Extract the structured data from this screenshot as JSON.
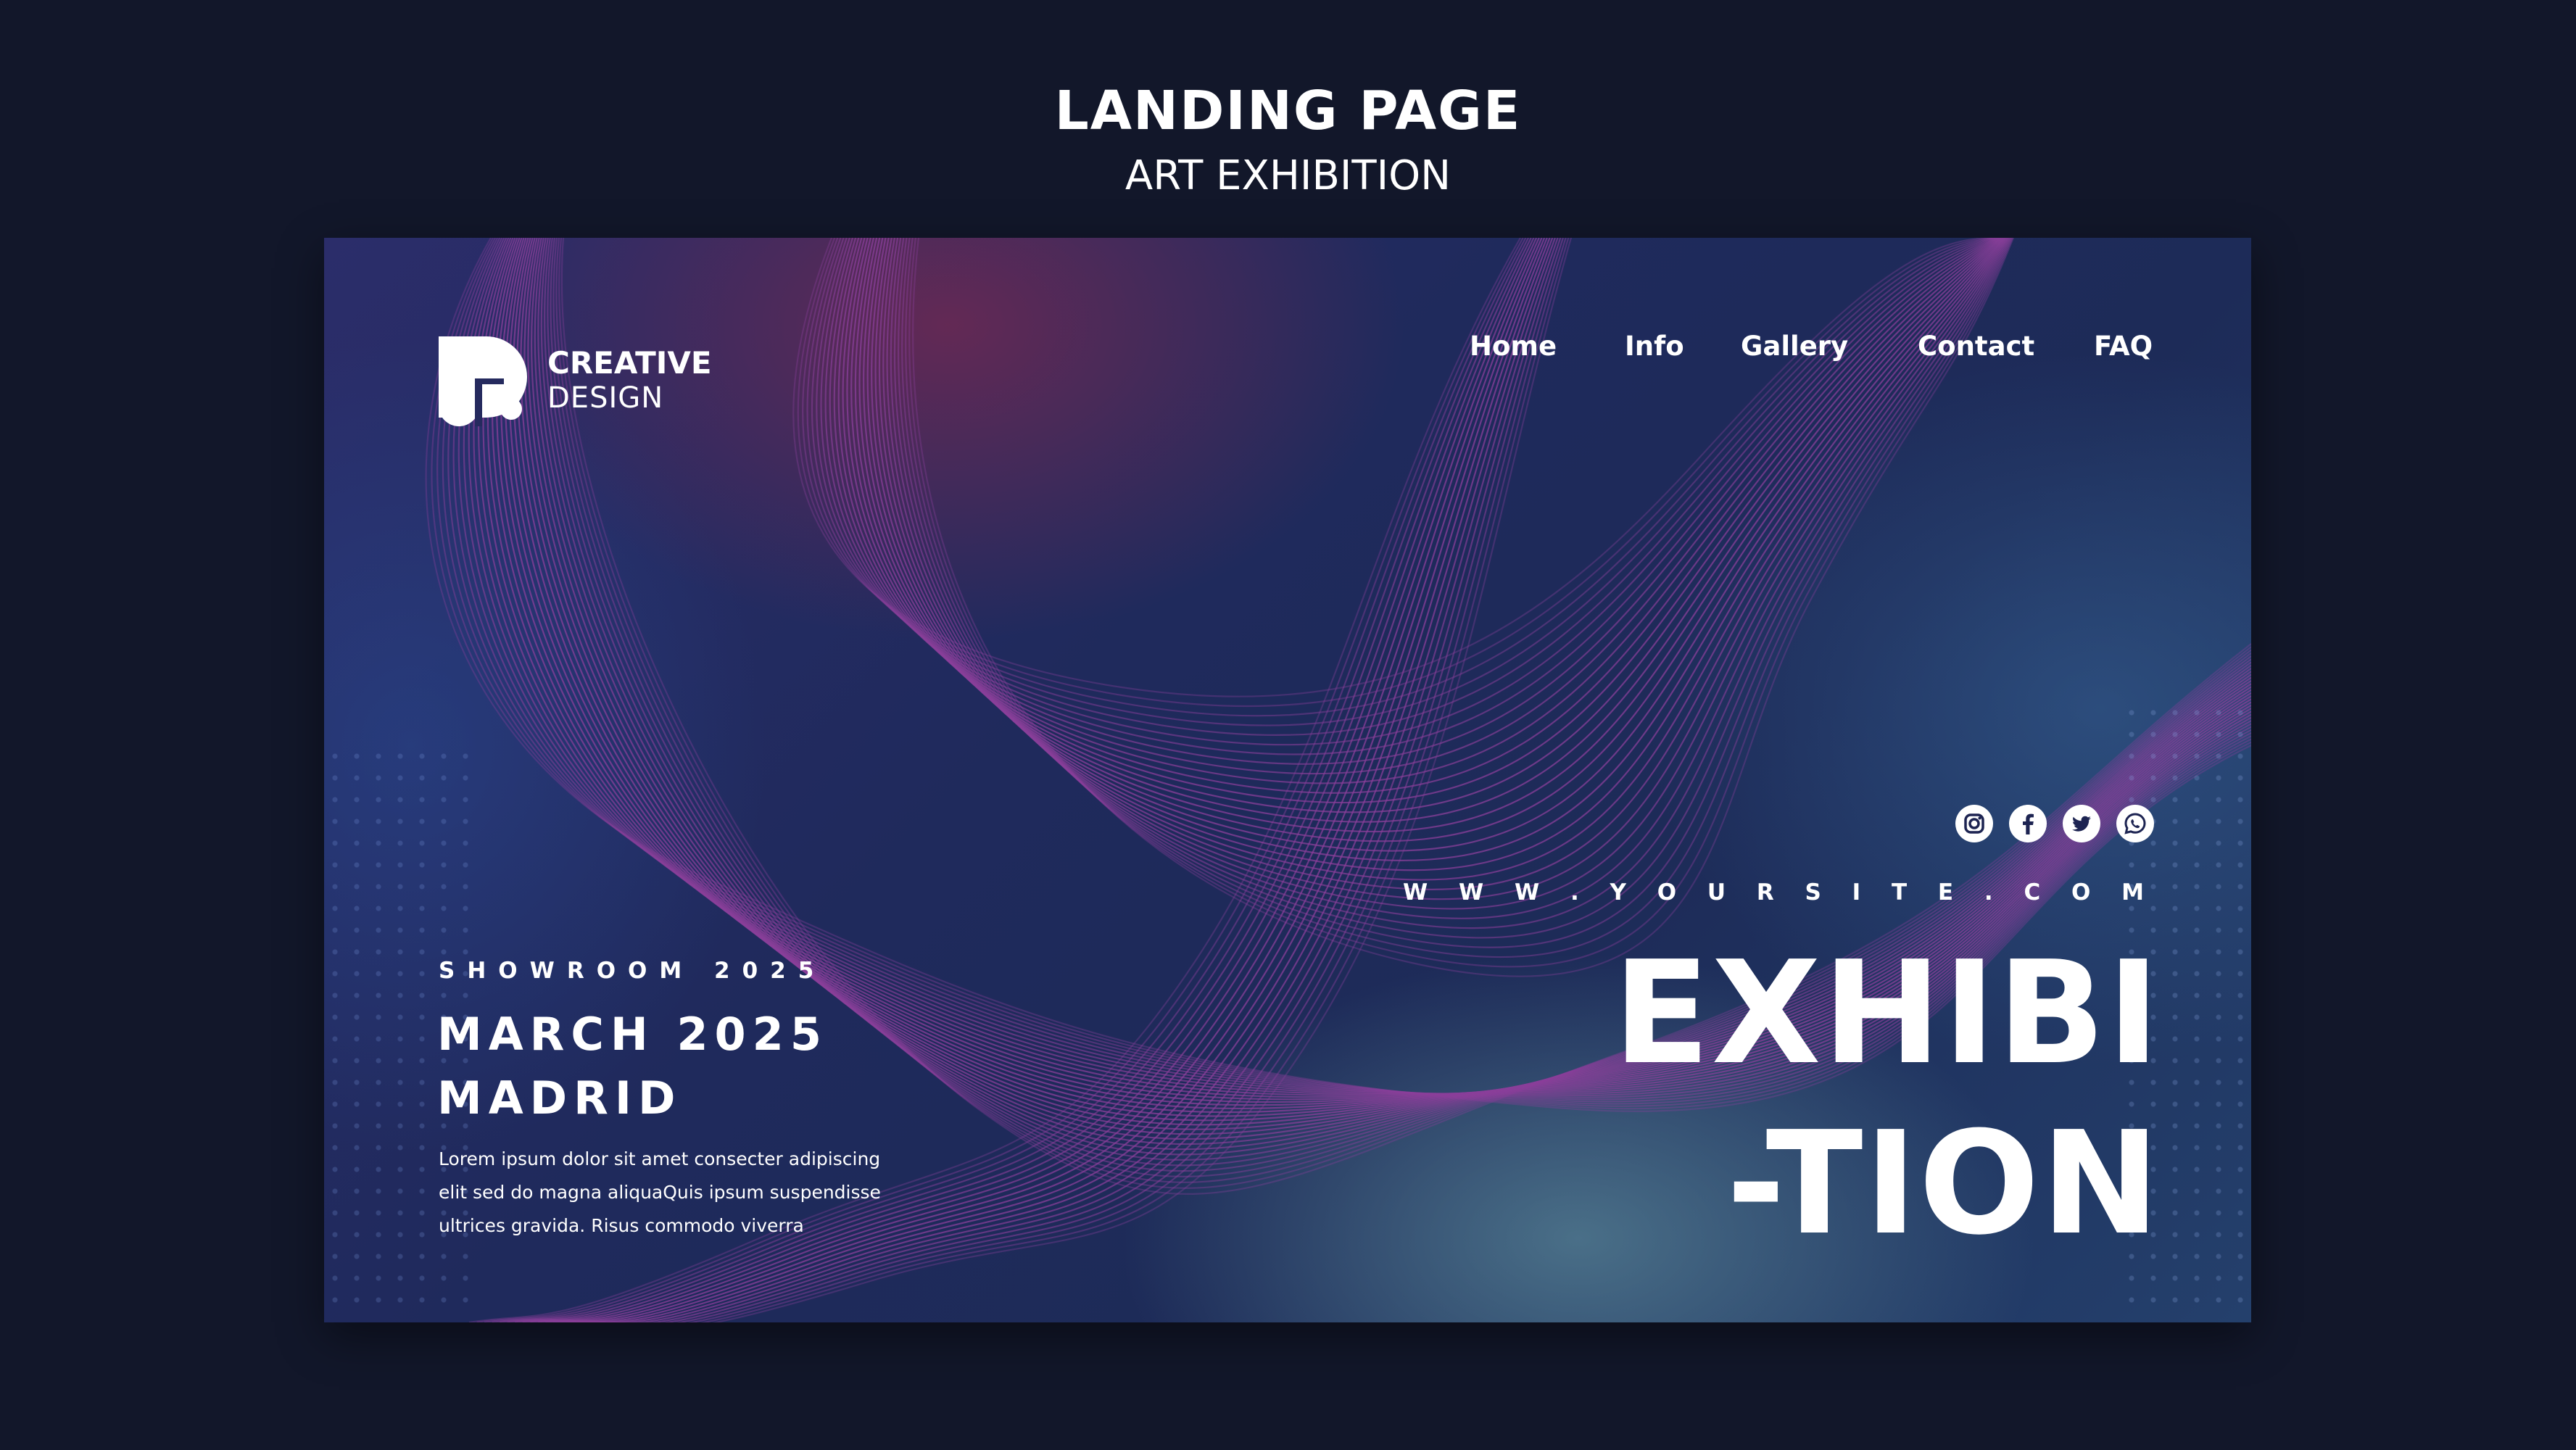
{
  "page": {
    "title": "LANDING PAGE",
    "subtitle": "ART EXHIBITION"
  },
  "logo": {
    "line1": "CREATIVE",
    "line2": "DESIGN",
    "icon": "logo-p-mark"
  },
  "nav": {
    "items": [
      {
        "label": "Home"
      },
      {
        "label": "Info"
      },
      {
        "label": "Gallery"
      },
      {
        "label": "Contact"
      },
      {
        "label": "FAQ"
      }
    ]
  },
  "social": {
    "icons": [
      "instagram-icon",
      "facebook-icon",
      "twitter-icon",
      "whatsapp-icon"
    ]
  },
  "hero": {
    "site_url": "W W W . Y O U R S I T E . C O M",
    "headline_line1": "EXHIBI",
    "headline_line2": "-TION",
    "showroom": "SHOWROOM 2025",
    "date": "MARCH 2025",
    "city": "MADRID",
    "description": [
      "Lorem ipsum dolor sit amet consecter adipiscing",
      "elit sed do magna  aliquaQuis ipsum suspendisse",
      "ultrices gravida. Risus commodo viverra"
    ]
  },
  "colors": {
    "page_background": "#12172a",
    "banner_base": "#1f2a5c",
    "wave_lines": "#8a3f9a",
    "text": "#ffffff"
  }
}
